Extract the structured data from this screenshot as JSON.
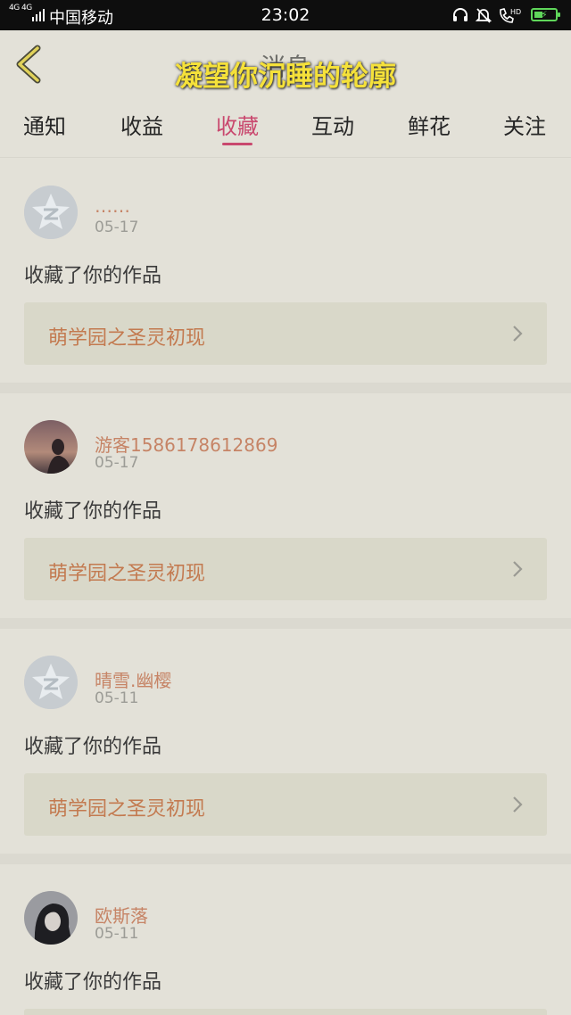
{
  "status_bar": {
    "network": "4G 4G",
    "carrier": "中国移动",
    "time": "23:02",
    "icons": [
      "headset-icon",
      "bell-muted-icon",
      "hd-call-icon",
      "battery-charging-icon"
    ],
    "hd_label": "HD"
  },
  "header": {
    "title": "消息",
    "overlay_caption": "凝望你沉睡的轮廓"
  },
  "tabs": [
    {
      "label": "通知"
    },
    {
      "label": "收益"
    },
    {
      "label": "收藏"
    },
    {
      "label": "互动"
    },
    {
      "label": "鲜花"
    },
    {
      "label": "关注"
    }
  ],
  "active_tab": "收藏",
  "feed": [
    {
      "username": "……",
      "date": "05-17",
      "action": "收藏了你的作品",
      "work_title": "萌学园之圣灵初现",
      "avatar": "default-avatar"
    },
    {
      "username": "游客1586178612869",
      "date": "05-17",
      "action": "收藏了你的作品",
      "work_title": "萌学园之圣灵初现",
      "avatar": "photo-avatar"
    },
    {
      "username": "晴雪.幽樱",
      "date": "05-11",
      "action": "收藏了你的作品",
      "work_title": "萌学园之圣灵初现",
      "avatar": "default-avatar"
    },
    {
      "username": "欧斯落",
      "date": "05-11",
      "action": "收藏了你的作品",
      "work_title": "",
      "avatar": "photo-avatar"
    }
  ],
  "colors": {
    "accent": "#c9486e",
    "username": "#c68466",
    "work_title": "#c37a50",
    "background": "#e3e1d8",
    "caption": "#f5e13a"
  }
}
